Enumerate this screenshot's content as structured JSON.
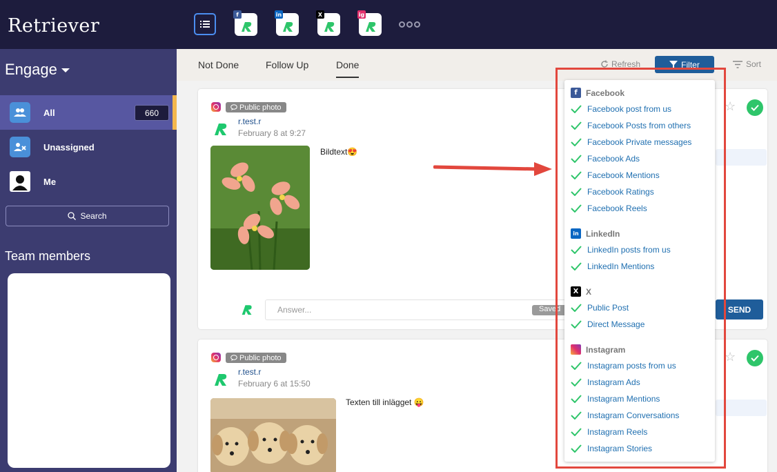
{
  "brand": {
    "logo_text": "Retriever"
  },
  "topbar": {
    "sources": [
      {
        "badge": "f",
        "badge_color": "#3b5998"
      },
      {
        "badge": "in",
        "badge_color": "#0a66c2"
      },
      {
        "badge": "X",
        "badge_color": "#000000"
      },
      {
        "badge": "ig",
        "badge_color": "#e1306c"
      }
    ]
  },
  "sidebar": {
    "title": "Engage",
    "items": [
      {
        "label": "All",
        "count": "660"
      },
      {
        "label": "Unassigned"
      },
      {
        "label": "Me"
      }
    ],
    "search_label": "Search",
    "team_title": "Team members"
  },
  "tabs": {
    "not_done": "Not Done",
    "follow_up": "Follow Up",
    "done": "Done",
    "refresh": "Refresh",
    "filter": "Filter",
    "sort": "Sort"
  },
  "posts": [
    {
      "type": "Public photo",
      "author": "r.test.r",
      "date": "February 8 at 9:27",
      "text": "Bildtext😍"
    },
    {
      "type": "Public photo",
      "author": "r.test.r",
      "date": "February 6 at 15:50",
      "text": "Texten till inlägget 😛"
    }
  ],
  "reply": {
    "placeholder": "Answer...",
    "saved_label": "Saved",
    "send_label": "SEND"
  },
  "filter_menu": {
    "groups": [
      {
        "name": "Facebook",
        "icon": "facebook-icon",
        "items": [
          "Facebook post from us",
          "Facebook Posts from others",
          "Facebook Private messages",
          "Facebook Ads",
          "Facebook Mentions",
          "Facebook Ratings",
          "Facebook Reels"
        ]
      },
      {
        "name": "LinkedIn",
        "icon": "linkedin-icon",
        "items": [
          "LinkedIn posts from us",
          "LinkedIn Mentions"
        ]
      },
      {
        "name": "X",
        "icon": "x-icon",
        "items": [
          "Public Post",
          "Direct Message"
        ]
      },
      {
        "name": "Instagram",
        "icon": "instagram-icon",
        "items": [
          "Instagram posts from us",
          "Instagram Ads",
          "Instagram Mentions",
          "Instagram Conversations",
          "Instagram Reels",
          "Instagram Stories"
        ]
      }
    ]
  },
  "colors": {
    "navy": "#1d1c3d",
    "sidebar": "#3c3c70",
    "accent_blue": "#1f5d9a",
    "check_green": "#2ec56a",
    "highlight_red": "#e2473d"
  }
}
